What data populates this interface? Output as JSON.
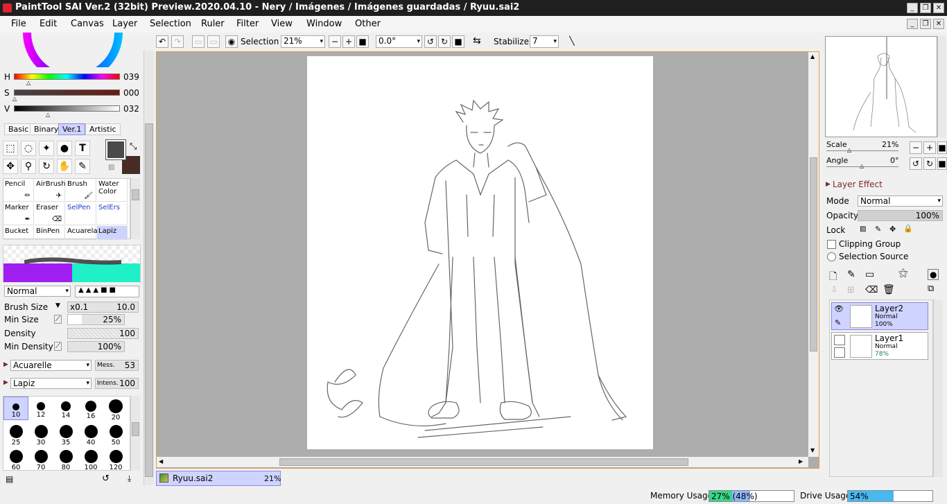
{
  "window": {
    "title": "PaintTool SAI Ver.2 (32bit) Preview.2020.04.10 - Nery / Imágenes / Imágenes guardadas / Ryuu.sai2"
  },
  "menu": [
    "File",
    "Edit",
    "Canvas",
    "Layer",
    "Selection",
    "Ruler",
    "Filter",
    "View",
    "Window",
    "Other"
  ],
  "color": {
    "h_label": "H",
    "h_value": "039",
    "s_label": "S",
    "s_value": "000",
    "v_label": "V",
    "v_value": "032",
    "primary": "#4a4a4a",
    "secondary": "#4a2a24"
  },
  "tool_tabs": [
    "Basic",
    "Binary",
    "Ver.1",
    "Artistic"
  ],
  "brushes": [
    {
      "label": "Pencil"
    },
    {
      "label": "AirBrush"
    },
    {
      "label": "Brush"
    },
    {
      "label": "Water Color"
    },
    {
      "label": "Marker"
    },
    {
      "label": "Eraser"
    },
    {
      "label": "SelPen"
    },
    {
      "label": "SelErs"
    },
    {
      "label": "Bucket"
    },
    {
      "label": "BinPen"
    },
    {
      "label": "Acuarela"
    },
    {
      "label": "Lapiz"
    }
  ],
  "brush_settings": {
    "blend_mode": "Normal",
    "brush_size_label": "Brush Size",
    "brush_size_mult": "x0.1",
    "brush_size_value": "10.0",
    "min_size_label": "Min Size",
    "min_size_value": "25%",
    "min_size_fraction": 0.25,
    "density_label": "Density",
    "density_value": "100",
    "min_density_label": "Min Density",
    "min_density_value": "100%",
    "texture1": "Acuarelle",
    "texture1_param_label": "Mess.",
    "texture1_param_value": "53",
    "texture2": "Lapiz",
    "texture2_param_label": "Intens.",
    "texture2_param_value": "100"
  },
  "sizes": [
    "10",
    "12",
    "14",
    "16",
    "20",
    "25",
    "30",
    "35",
    "40",
    "50",
    "60",
    "70",
    "80",
    "100",
    "120"
  ],
  "toolbar": {
    "selection_label": "Selection",
    "zoom": "21%",
    "angle": "0.0°",
    "stabilizer_label": "Stabilizer",
    "stabilizer_value": "7"
  },
  "navigator": {
    "scale_label": "Scale",
    "scale_value": "21%",
    "angle_label": "Angle",
    "angle_value": "0°"
  },
  "layer_panel": {
    "effect_label": "Layer Effect",
    "mode_label": "Mode",
    "mode_value": "Normal",
    "opacity_label": "Opacity",
    "opacity_value": "100%",
    "lock_label": "Lock",
    "clipping_label": "Clipping Group",
    "selection_source_label": "Selection Source",
    "layers": [
      {
        "name": "Layer2",
        "mode": "Normal",
        "opacity": "100%"
      },
      {
        "name": "Layer1",
        "mode": "Normal",
        "opacity": "78%"
      }
    ]
  },
  "document_tab": {
    "name": "Ryuu.sai2",
    "zoom": "21%"
  },
  "status": {
    "memory_label": "Memory Usage",
    "memory_value": "27% (48%)",
    "memory_fraction": 0.27,
    "memory_fraction2": 0.48,
    "drive_label": "Drive Usage",
    "drive_value": "54%",
    "drive_fraction": 0.54
  }
}
